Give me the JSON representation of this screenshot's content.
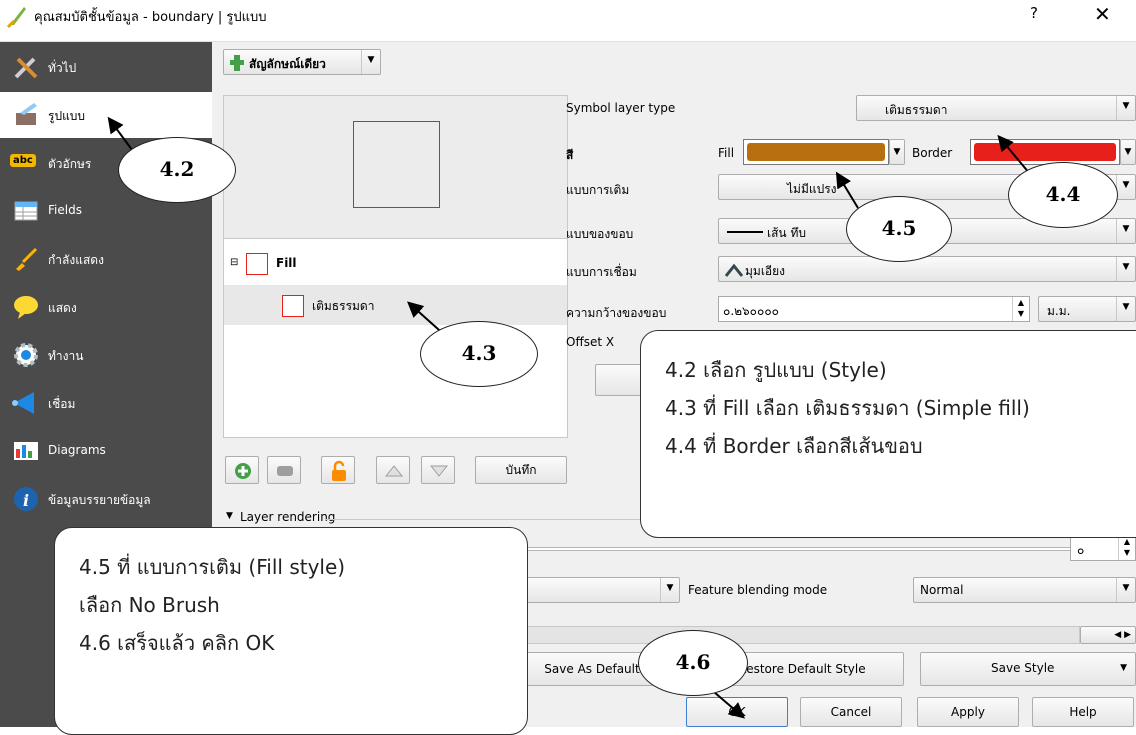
{
  "window": {
    "title": "คุณสมบัติชั้นข้อมูล - boundary | รูปแบบ",
    "help_label": "?",
    "close_label": "✕"
  },
  "sidebar": {
    "items": [
      {
        "label": "ทั่วไป",
        "icon": "tools-icon"
      },
      {
        "label": "รูปแบบ",
        "icon": "paintbrush-icon"
      },
      {
        "label": "ตัวอักษร",
        "icon": "abc-label-icon"
      },
      {
        "label": "Fields",
        "icon": "table-icon"
      },
      {
        "label": "กำลังแสดง",
        "icon": "brush-icon"
      },
      {
        "label": "แสดง",
        "icon": "speech-bubble-icon"
      },
      {
        "label": "ทำงาน",
        "icon": "gear-icon"
      },
      {
        "label": "เชื่อม",
        "icon": "join-icon"
      },
      {
        "label": "Diagrams",
        "icon": "chart-icon"
      },
      {
        "label": "ข้อมูลบรรยายข้อมูล",
        "icon": "info-icon"
      }
    ],
    "abc_badge": "abc"
  },
  "style": {
    "renderer_label": "สัญลักษณ์เดียว",
    "tree": {
      "root": "Fill",
      "child": "เติมธรรมดา"
    },
    "save_button": "บันทึก",
    "symbol_layer_type_label": "Symbol layer type",
    "symbol_layer_type_value": "เติมธรรมดา",
    "color_label": "สี",
    "fill_label": "Fill",
    "border_label": "Border",
    "fill_style_label": "แบบการเติม",
    "fill_style_value": "ไม่มีแปรง",
    "border_style_label": "แบบของขอบ",
    "border_style_value": "เส้น ทึบ",
    "join_style_label": "แบบการเชื่อม",
    "join_style_value": "มุมเอียง",
    "border_width_label": "ความกว้างของขอบ",
    "border_width_value": "๐.๒๖๐๐๐๐",
    "unit_value": "ม.ม.",
    "offset_label": "Offset X",
    "layer_rendering_label": "Layer rendering",
    "opacity_value": "๐",
    "feature_blending_label": "Feature blending mode",
    "feature_blending_value": "Normal",
    "save_as_default": "Save As Default",
    "restore_default": "Restore Default Style",
    "save_style": "Save Style"
  },
  "buttons": {
    "ok": "OK",
    "cancel": "Cancel",
    "apply": "Apply",
    "help": "Help"
  },
  "colors": {
    "fill": "#b86f10",
    "border": "#e8201c",
    "sidebar": "#4b4b4b"
  },
  "annotations": {
    "bubble_42": "4.2",
    "bubble_43": "4.3",
    "bubble_44": "4.4",
    "bubble_45": "4.5",
    "bubble_46": "4.6",
    "note1_line1": "4.2 เลือก รูปแบบ (Style)",
    "note1_line2": "4.3 ที่ Fill เลือก เติมธรรมดา (Simple fill)",
    "note1_line3": "4.4 ที่ Border  เลือกสีเส้นขอบ",
    "note2_line1": "4.5 ที่ แบบการเติม (Fill style)",
    "note2_line2": "เลือก No Brush",
    "note2_line3": "4.6 เสร็จแล้ว คลิก OK"
  }
}
